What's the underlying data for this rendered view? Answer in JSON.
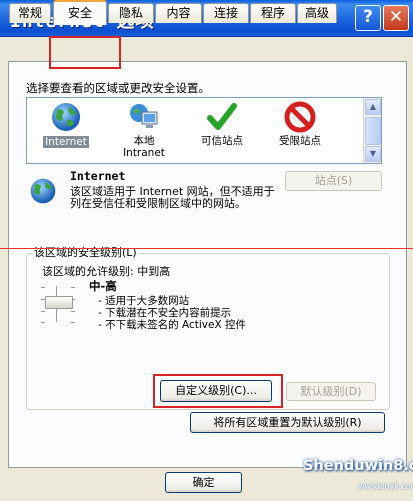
{
  "window": {
    "title": "Internet 选项",
    "help_glyph": "?",
    "close_glyph": "✕"
  },
  "tabs": [
    {
      "label": "常规"
    },
    {
      "label": "安全"
    },
    {
      "label": "隐私"
    },
    {
      "label": "内容"
    },
    {
      "label": "连接"
    },
    {
      "label": "程序"
    },
    {
      "label": "高级"
    }
  ],
  "active_tab": "安全",
  "zones_prompt": "选择要查看的区域或更改安全设置。",
  "zones": [
    {
      "label": "Internet",
      "icon": "globe-icon",
      "selected": true
    },
    {
      "label": "本地 Intranet",
      "line1": "本地",
      "line2": "Intranet",
      "icon": "intranet-computer-icon"
    },
    {
      "label": "可信站点",
      "icon": "checkmark-icon"
    },
    {
      "label": "受限站点",
      "icon": "no-entry-icon"
    }
  ],
  "zone_info": {
    "title": "Internet",
    "description": "该区域适用于 Internet 网站，但不适用于列在受信任和受限制区域中的网站。",
    "sites_button": "站点(S)"
  },
  "security_level": {
    "group_label": "该区域的安全级别(L)",
    "allowed_text": "该区域的允许级别: 中到高",
    "level_name": "中-高",
    "bullets": [
      "- 适用于大多数网站",
      "- 下载潜在不安全内容前提示",
      "- 不下载未签名的 ActiveX 控件"
    ],
    "custom_button": "自定义级别(C)...",
    "default_button": "默认级别(D)",
    "reset_all_button": "将所有区域重置为默认级别(R)"
  },
  "footer": {
    "ok_button": "确定"
  },
  "watermark": {
    "text": "Shenduwin8.com",
    "sub": "ww.kkinyk.com"
  },
  "colors": {
    "titlebar": "#0b50d0",
    "highlight_red": "#d72323",
    "panel_bg": "#fcfcfe",
    "dialog_bg": "#ece9d8"
  }
}
